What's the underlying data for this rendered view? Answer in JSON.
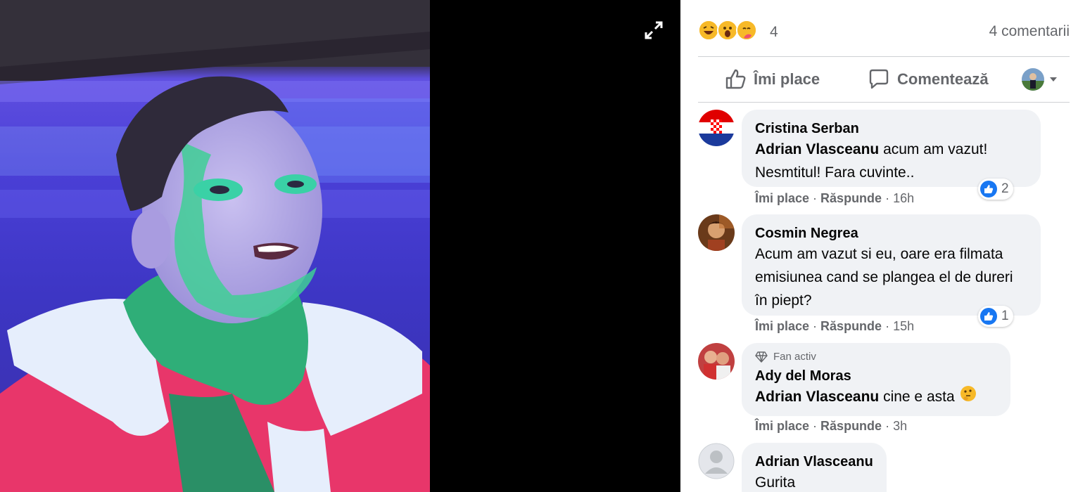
{
  "reactions": {
    "emojis": [
      "haha-emoji",
      "wow-emoji",
      "care-emoji"
    ],
    "count": "4",
    "comments_count": "4 comentarii"
  },
  "actions": {
    "like": "Îmi place",
    "comment": "Comentează"
  },
  "comments": [
    {
      "author": "Cristina Serban",
      "mention": "Adrian Vlasceanu",
      "text": " acum am vazut! Nesmtitul! Fara cuvinte..",
      "like": "Îmi place",
      "reply": "Răspunde",
      "time": "16h",
      "likes": "2"
    },
    {
      "author": "Cosmin Negrea",
      "text": "Acum am vazut si eu, oare era filmata emisiunea cand se plangea el de dureri în piept?",
      "like": "Îmi place",
      "reply": "Răspunde",
      "time": "15h",
      "likes": "1"
    },
    {
      "badge": "Fan activ",
      "author": "Ady del Moras",
      "mention": "Adrian Vlasceanu",
      "text": " cine e asta ",
      "emoji": "thinking-emoji",
      "like": "Îmi place",
      "reply": "Răspunde",
      "time": "3h"
    },
    {
      "author": "Adrian Vlasceanu",
      "text": "Gurita"
    }
  ],
  "colors": {
    "accent": "#1877f2",
    "bubble": "#f0f2f5",
    "muted": "#65676b"
  }
}
